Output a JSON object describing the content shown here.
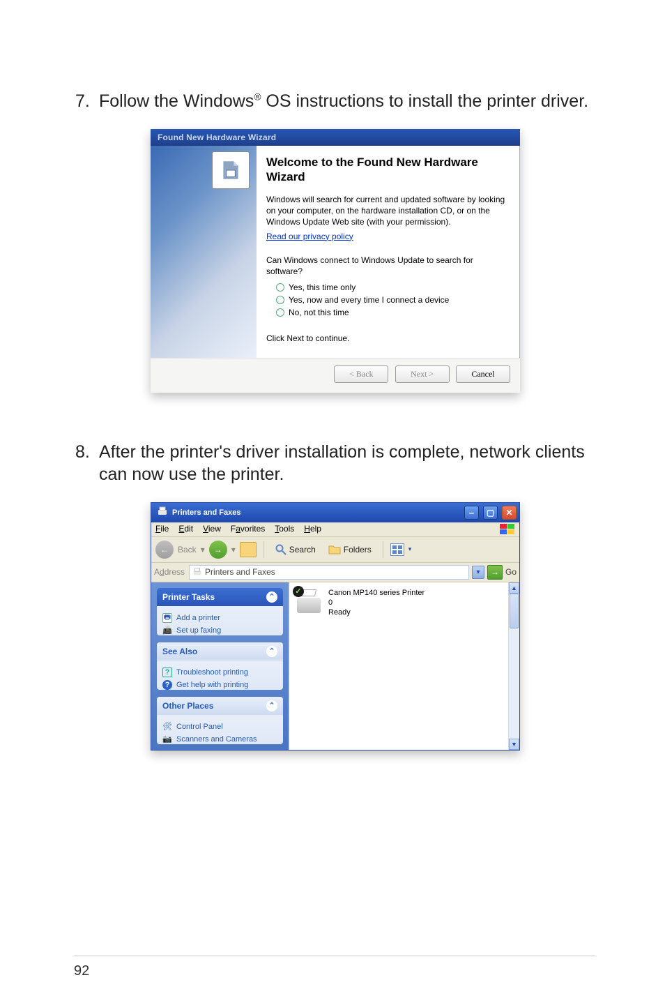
{
  "steps": {
    "s7": {
      "num": "7.",
      "text_before": "Follow the Windows",
      "reg": "®",
      "text_after": " OS instructions to install the printer driver."
    },
    "s8": {
      "num": "8.",
      "text": "After the printer's driver installation is complete, network clients can now use the printer."
    }
  },
  "wizard": {
    "title": "Found New Hardware Wizard",
    "heading": "Welcome to the Found New Hardware Wizard",
    "intro": "Windows will search for current and updated software by looking on your computer, on the hardware installation CD, or on the Windows Update Web site (with your permission).",
    "privacy_link": "Read our privacy policy",
    "question": "Can Windows connect to Windows Update to search for software?",
    "opt1": "Yes, this time only",
    "opt2": "Yes, now and every time I connect a device",
    "opt3": "No, not this time",
    "continue_text": "Click Next to continue.",
    "btn_back": "< Back",
    "btn_next": "Next >",
    "btn_cancel": "Cancel"
  },
  "pf": {
    "title": "Printers and Faxes",
    "menus": {
      "file": "File",
      "edit": "Edit",
      "view": "View",
      "fav": "Favorites",
      "tools": "Tools",
      "help": "Help"
    },
    "menu_accel": {
      "file": "F",
      "edit": "E",
      "view": "V",
      "fav": "a",
      "tools": "T",
      "help": "H"
    },
    "toolbar": {
      "back": "Back",
      "search": "Search",
      "folders": "Folders"
    },
    "address": {
      "label": "Address",
      "text": "Printers and Faxes",
      "go": "Go"
    },
    "side": {
      "tasks": {
        "title": "Printer Tasks",
        "add": "Add a printer",
        "fax": "Set up faxing"
      },
      "seealso": {
        "title": "See Also",
        "trouble": "Troubleshoot printing",
        "gethelp": "Get help with printing"
      },
      "other": {
        "title": "Other Places",
        "cp": "Control Panel",
        "scan": "Scanners and Cameras"
      }
    },
    "printer": {
      "name": "Canon MP140 series Printer",
      "queue": "0",
      "status": "Ready"
    }
  },
  "page_number": "92"
}
